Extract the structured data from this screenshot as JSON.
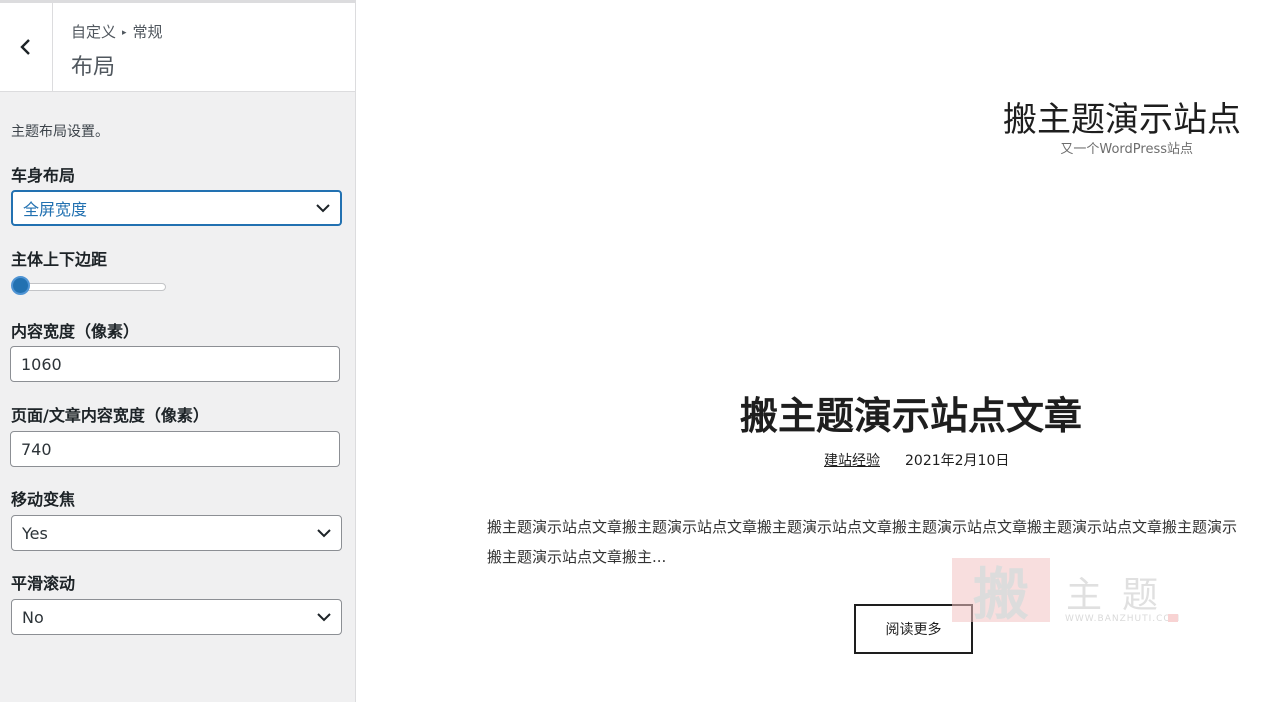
{
  "sidebar": {
    "breadcrumb": {
      "parent": "自定义",
      "current": "常规"
    },
    "title": "布局",
    "description": "主题布局设置。",
    "fields": {
      "body_layout": {
        "label": "车身布局",
        "value": "全屏宽度"
      },
      "body_margin": {
        "label": "主体上下边距",
        "value": 0
      },
      "content_width": {
        "label": "内容宽度（像素）",
        "value": "1060"
      },
      "page_width": {
        "label": "页面/文章内容宽度（像素）",
        "value": "740"
      },
      "mobile_focus": {
        "label": "移动变焦",
        "value": "Yes"
      },
      "smooth_scroll": {
        "label": "平滑滚动",
        "value": "No"
      }
    }
  },
  "preview": {
    "site_title": "搬主题演示站点",
    "site_tagline": "又一个WordPress站点",
    "post": {
      "title": "搬主题演示站点文章",
      "category": "建站经验",
      "date": "2021年2月10日",
      "excerpt_line1": "搬主题演示站点文章搬主题演示站点文章搬主题演示站点文章搬主题演示站点文章搬主题演示站点文章搬主题演示",
      "excerpt_line2": "搬主题演示站点文章搬主...",
      "read_more": "阅读更多"
    },
    "watermark": {
      "logo_char": "搬",
      "text": "主题",
      "url": "WWW.BANZHUTI.COM"
    }
  },
  "colors": {
    "accent": "#2271b1",
    "sidebar_bg": "#f0f0f1"
  },
  "icons": {
    "back": "chevron-left-icon",
    "dropdown": "chevron-down-icon"
  }
}
